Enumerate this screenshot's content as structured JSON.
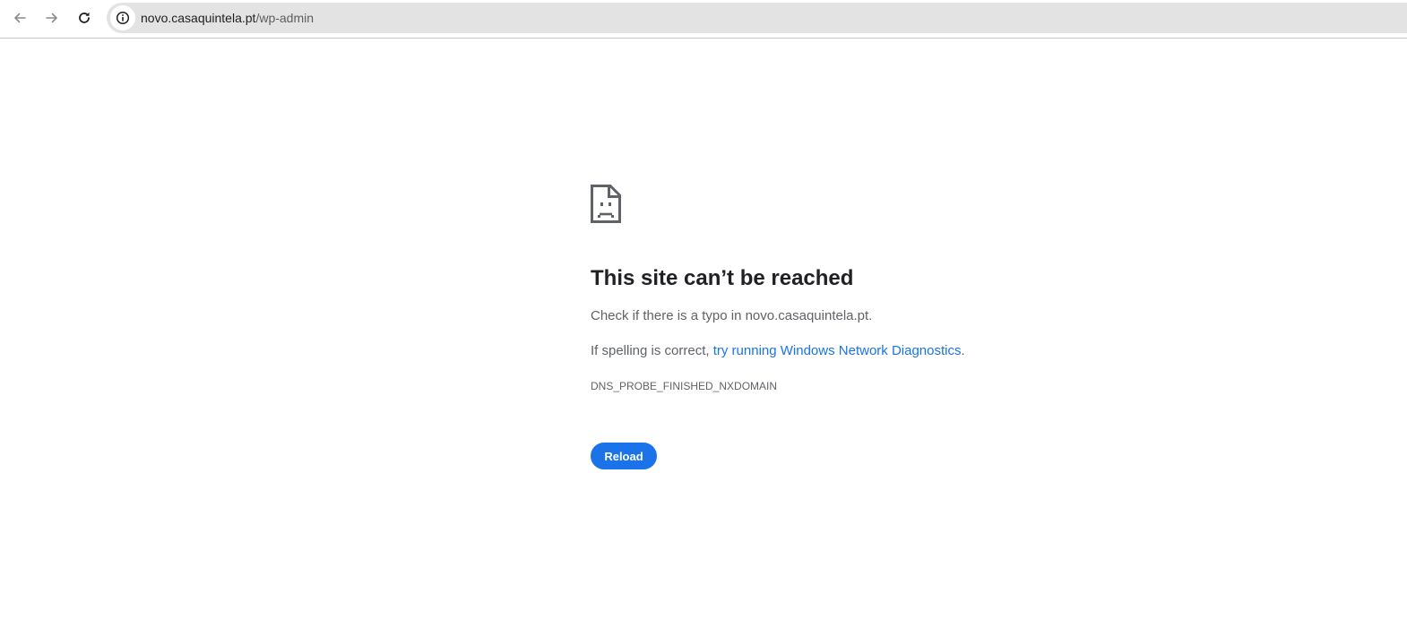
{
  "browser": {
    "url_host": "novo.casaquintela.pt",
    "url_path": "/wp-admin",
    "icons": {
      "back": "arrow-back-icon",
      "forward": "arrow-forward-icon",
      "reload": "reload-icon",
      "site_info": "info-icon"
    }
  },
  "error_page": {
    "icon": "sad-page-icon",
    "title": "This site can’t be reached",
    "typo_hint": "Check if there is a typo in novo.casaquintela.pt.",
    "spelling_prefix": "If spelling is correct, ",
    "diagnostics_link": "try running Windows Network Diagnostics",
    "spelling_suffix": ".",
    "error_code": "DNS_PROBE_FINISHED_NXDOMAIN",
    "reload_label": "Reload"
  },
  "colors": {
    "accent": "#1a73e8",
    "title": "#202124",
    "body_text": "#5f6368",
    "omnibox_bg": "#e3e3e3"
  }
}
